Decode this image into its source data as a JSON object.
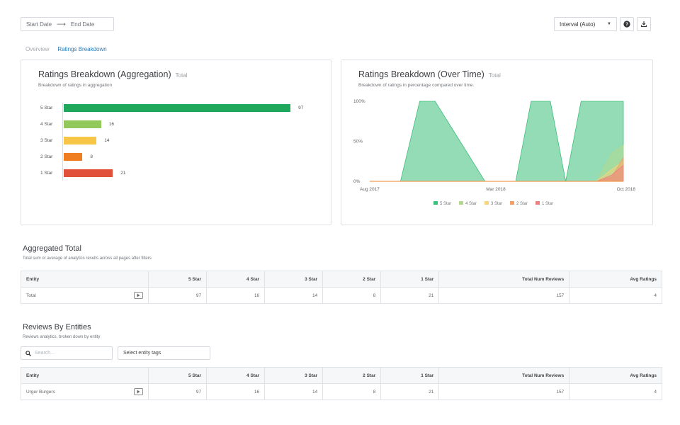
{
  "toolbar": {
    "start_date": "Start Date",
    "arrow": "⟶",
    "end_date": "End Date",
    "interval": "Interval (Auto)"
  },
  "tabs": [
    {
      "label": "Overview",
      "active": false
    },
    {
      "label": "Ratings Breakdown",
      "active": true
    }
  ],
  "aggregation_card": {
    "title": "Ratings Breakdown (Aggregation)",
    "title_suffix": "Total",
    "subtitle": "Breakdown of ratings in aggregation"
  },
  "overtime_card": {
    "title": "Ratings Breakdown (Over Time)",
    "title_suffix": "Total",
    "subtitle": "Breakdown of ratings in percentage compared over time."
  },
  "chart_data": [
    {
      "type": "bar",
      "orientation": "horizontal",
      "categories": [
        "5 Star",
        "4 Star",
        "3 Star",
        "2 Star",
        "1 Star"
      ],
      "values": [
        97,
        16,
        14,
        8,
        21
      ],
      "colors": [
        "#1fa85c",
        "#93c95a",
        "#f7c646",
        "#ef7e22",
        "#e0503a"
      ]
    },
    {
      "type": "area",
      "y_ticks": [
        "100%",
        "50%",
        "0%"
      ],
      "x_ticks": [
        "Aug 2017",
        "Mar 2018",
        "Oct 2018"
      ],
      "ylim": [
        0,
        100
      ],
      "x": [
        0,
        4,
        8,
        13,
        17,
        30,
        34,
        38,
        42,
        47,
        51,
        55,
        59,
        63,
        66
      ],
      "series": [
        {
          "name": "5 Star",
          "color": "#3cbf7a",
          "values": [
            0,
            0,
            0,
            100,
            100,
            0,
            0,
            0,
            100,
            100,
            0,
            100,
            100,
            100,
            100
          ]
        },
        {
          "name": "4 Star",
          "color": "#b4d98a",
          "values": [
            0,
            0,
            0,
            0,
            0,
            0,
            0,
            0,
            0,
            0,
            0,
            0,
            0,
            35,
            45
          ]
        },
        {
          "name": "3 Star",
          "color": "#f8d57a",
          "values": [
            0,
            0,
            0,
            0,
            0,
            0,
            0,
            0,
            0,
            0,
            0,
            0,
            0,
            15,
            25
          ]
        },
        {
          "name": "2 Star",
          "color": "#f2a066",
          "values": [
            0,
            0,
            0,
            0,
            0,
            0,
            0,
            0,
            0,
            0,
            0,
            0,
            0,
            5,
            30
          ]
        },
        {
          "name": "1 Star",
          "color": "#ec8080",
          "values": [
            0,
            0,
            0,
            0,
            0,
            0,
            0,
            0,
            0,
            0,
            0,
            0,
            0,
            8,
            20
          ]
        }
      ]
    }
  ],
  "aggregated": {
    "title": "Aggregated Total",
    "subtitle": "Total sum or average of analytics results across all pages after filters",
    "columns": [
      "Entity",
      "5 Star",
      "4 Star",
      "3 Star",
      "2 Star",
      "1 Star",
      "Total Num Reviews",
      "Avg Ratings"
    ],
    "row": {
      "entity": "Total",
      "cells": [
        "97",
        "16",
        "14",
        "8",
        "21",
        "157",
        "4"
      ]
    }
  },
  "entities": {
    "title": "Reviews By Entities",
    "subtitle": "Reviews analytics, broken down by entity",
    "search_placeholder": "Search...",
    "tags_label": "Select entity tags",
    "columns": [
      "Entity",
      "5 Star",
      "4 Star",
      "3 Star",
      "2 Star",
      "1 Star",
      "Total Num Reviews",
      "Avg Ratings"
    ],
    "row": {
      "entity": "Urger Burgers",
      "cells": [
        "97",
        "16",
        "14",
        "8",
        "21",
        "157",
        "4"
      ]
    }
  }
}
